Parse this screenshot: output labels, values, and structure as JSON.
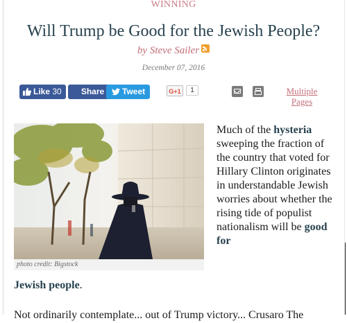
{
  "article": {
    "category": "WINNING",
    "title": "Will Trump be Good for the Jewish People?",
    "byline": "by Steve Sailer",
    "date": "December 07, 2016"
  },
  "share": {
    "like_label": "Like",
    "like_count": "30",
    "share_label": "Share",
    "tweet_label": "Tweet",
    "gplus_label": "G+1",
    "gplus_count": "1",
    "multipage_label": "Multiple Pages"
  },
  "image": {
    "credit": "photo credit: Bigstock"
  },
  "content": {
    "p1_start": "Much of the ",
    "p1_link1": "hysteria",
    "p1_mid": " sweeping the fraction of the country that voted for Hillary Clinton originates in understandable Jewish worries about whether the rising tide of populist nationalism will be ",
    "p1_link2": "good for",
    "p1_link2b": "Jewish people",
    "p1_end": ".",
    "next_line": "Not ordinarily contemplate... out of Trump victory... Crusaro The"
  },
  "colors": {
    "title": "#27424e",
    "accent": "#c46e79",
    "facebook": "#3b5998",
    "twitter": "#2a9ae0"
  }
}
